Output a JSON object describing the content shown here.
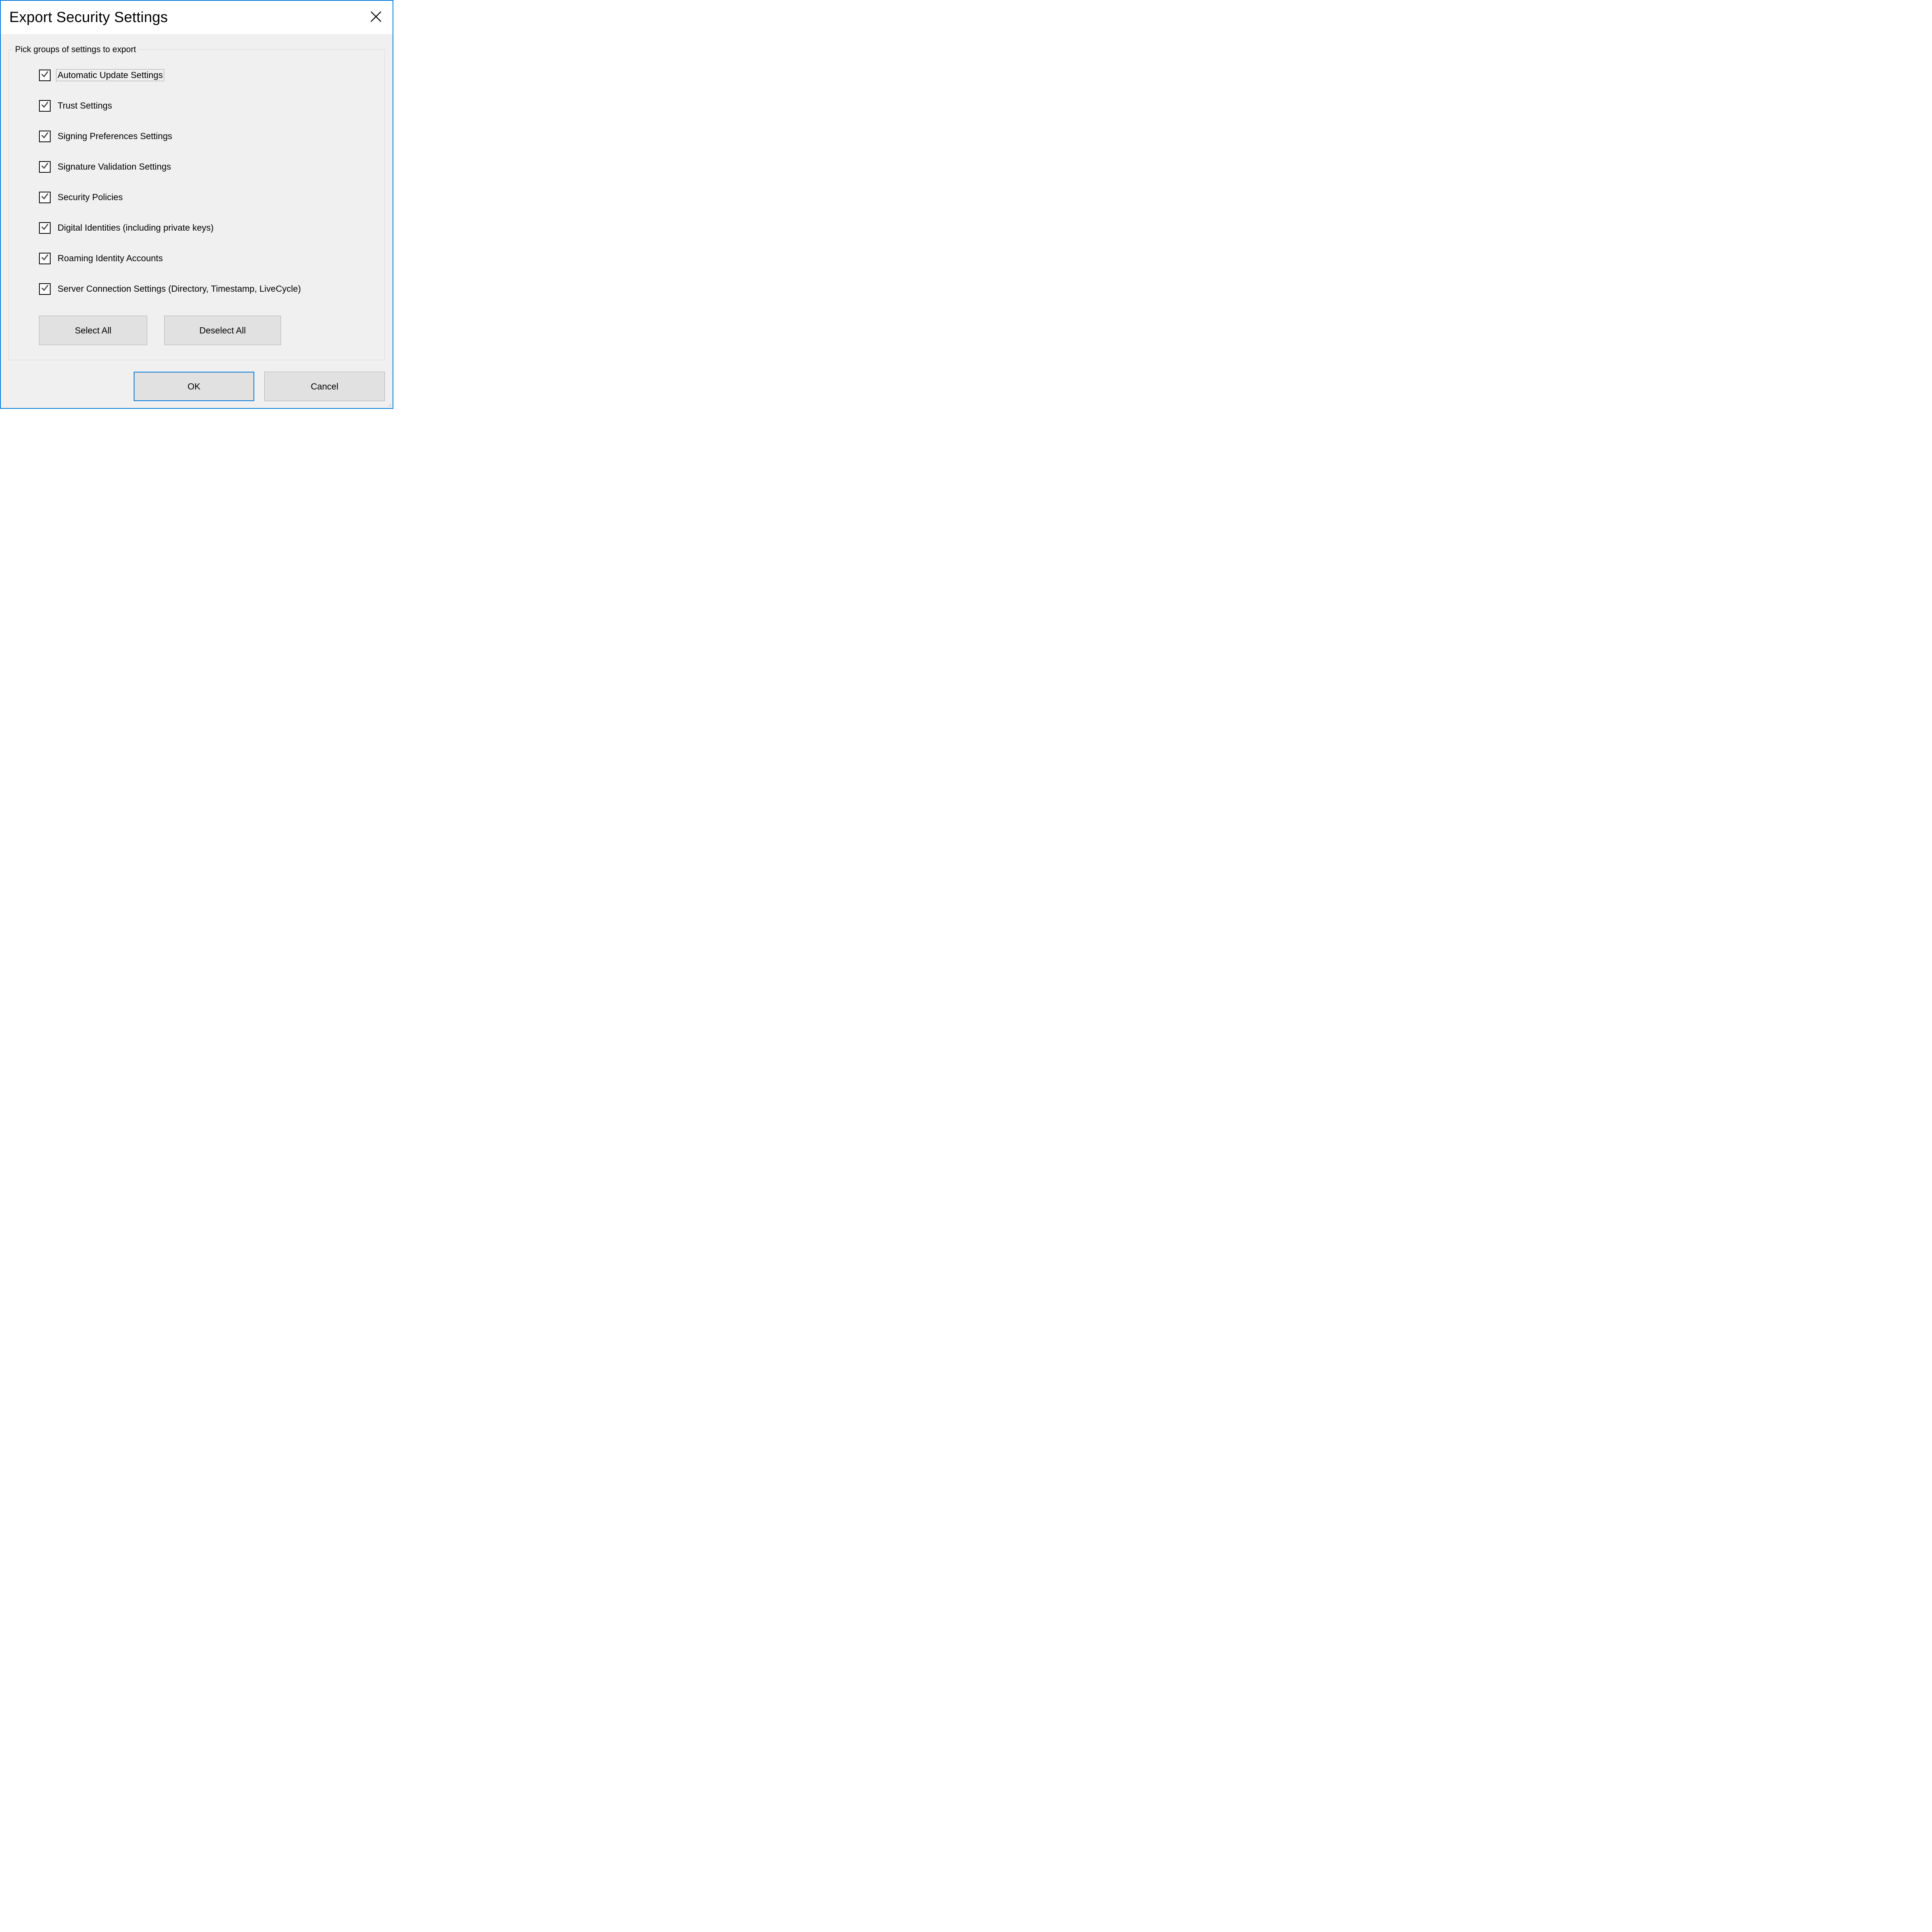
{
  "window": {
    "title": "Export Security Settings"
  },
  "fieldset": {
    "legend": "Pick groups of settings to export"
  },
  "options": [
    {
      "label": "Automatic Update Settings",
      "checked": true,
      "focused": true
    },
    {
      "label": "Trust Settings",
      "checked": true,
      "focused": false
    },
    {
      "label": "Signing Preferences Settings",
      "checked": true,
      "focused": false
    },
    {
      "label": "Signature Validation Settings",
      "checked": true,
      "focused": false
    },
    {
      "label": "Security Policies",
      "checked": true,
      "focused": false
    },
    {
      "label": "Digital Identities (including private keys)",
      "checked": true,
      "focused": false
    },
    {
      "label": "Roaming Identity Accounts",
      "checked": true,
      "focused": false
    },
    {
      "label": "Server Connection Settings (Directory, Timestamp, LiveCycle)",
      "checked": true,
      "focused": false
    }
  ],
  "buttons": {
    "select_all": "Select All",
    "deselect_all": "Deselect All",
    "ok": "OK",
    "cancel": "Cancel"
  }
}
